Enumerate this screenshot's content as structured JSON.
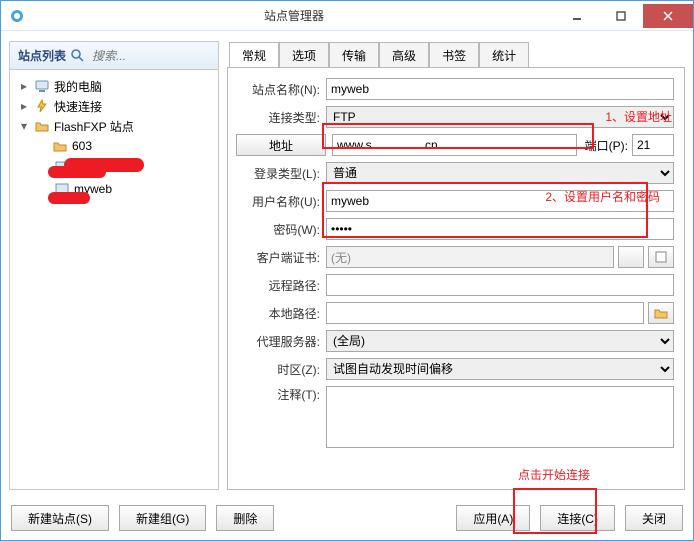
{
  "window": {
    "title": "站点管理器"
  },
  "sidebar": {
    "title": "站点列表",
    "search_placeholder": "搜索...",
    "nodes": {
      "my_computer": "我的电脑",
      "quick_connect": "快速连接",
      "flashfxp_sites": "FlashFXP 站点",
      "site_603": "603",
      "site_redacted": " ",
      "site_myweb": "myweb"
    }
  },
  "tabs": [
    "常规",
    "选项",
    "传输",
    "高级",
    "书签",
    "统计"
  ],
  "labels": {
    "site_name": "站点名称(N):",
    "conn_type": "连接类型:",
    "address_btn": "地址",
    "port": "端口(P):",
    "login_type": "登录类型(L):",
    "username": "用户名称(U):",
    "password": "密码(W):",
    "client_cert": "客户端证书:",
    "remote_path": "远程路径:",
    "local_path": "本地路径:",
    "proxy": "代理服务器:",
    "timezone": "时区(Z):",
    "notes": "注释(T):"
  },
  "values": {
    "site_name": "myweb",
    "conn_type": "FTP",
    "address": "www.s               .cn",
    "port": "21",
    "login_type": "普通",
    "username": "myweb",
    "password": "•••••",
    "client_cert": "(无)",
    "remote_path": "",
    "local_path": "",
    "proxy": "(全局)",
    "timezone": "试图自动发现时间偏移",
    "notes": ""
  },
  "annotations": {
    "a1": "1、设置地址",
    "a2": "2、设置用户名和密码",
    "a3": "点击开始连接"
  },
  "footer": {
    "new_site": "新建站点(S)",
    "new_group": "新建组(G)",
    "delete": "删除",
    "apply": "应用(A)",
    "connect": "连接(C)",
    "close": "关闭"
  }
}
